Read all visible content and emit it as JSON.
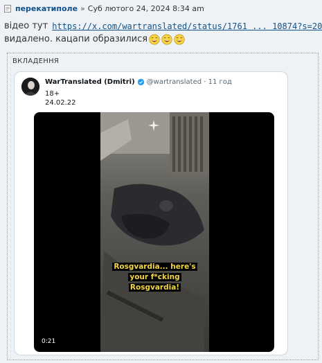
{
  "header": {
    "author": "перекатиполе",
    "separator": "»",
    "date": "Суб лютого 24, 2024 8:34 am"
  },
  "content": {
    "line1_prefix": "відео тут",
    "link": "https://x.com/wartranslated/status/1761 ... 10874?s=20",
    "line2_text": "видалено. кацапи образилися",
    "emoji_name": "laughing-emoji"
  },
  "attachments": {
    "title": "ВКЛАДЕННЯ"
  },
  "tweet": {
    "name": "WarTranslated (Dmitri)",
    "handle": "@wartranslated · 11 год",
    "text_line1": "18+",
    "text_line2": "24.02.22",
    "video": {
      "caption_line1": "Rosgvardia... here's",
      "caption_line2": "your f*cking",
      "caption_line3": "Rosgvardia!",
      "duration": "0:21"
    }
  },
  "colors": {
    "link": "#105289",
    "verified": "#1d9bf0",
    "caption": "#f5d742"
  }
}
